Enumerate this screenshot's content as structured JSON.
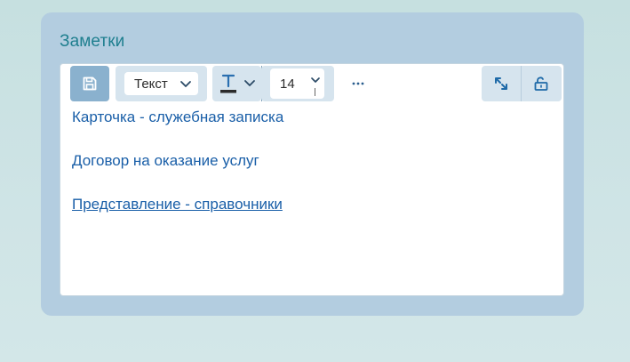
{
  "card": {
    "title": "Заметки"
  },
  "toolbar": {
    "save_icon": "save-icon",
    "format_select": {
      "value": "Текст",
      "icon": "chevron-down-icon"
    },
    "text_color": {
      "icon": "text-color-icon",
      "dropdown_icon": "chevron-down-icon"
    },
    "font_size": {
      "value": "14",
      "icon": "chevron-down-icon"
    },
    "more_icon": "more-horizontal-icon",
    "expand_icon": "expand-icon",
    "lock_icon": "unlock-icon"
  },
  "notes": {
    "lines": [
      "Карточка - служебная записка",
      "Договор на оказание услуг",
      "Представление - справочники"
    ]
  },
  "colors": {
    "title": "#1f7f8f",
    "text": "#1a5fa8",
    "card_bg": "#b3cde0",
    "save_button_bg": "#8ab1ce",
    "toolbar_group_bg": "#d6e4ee"
  }
}
